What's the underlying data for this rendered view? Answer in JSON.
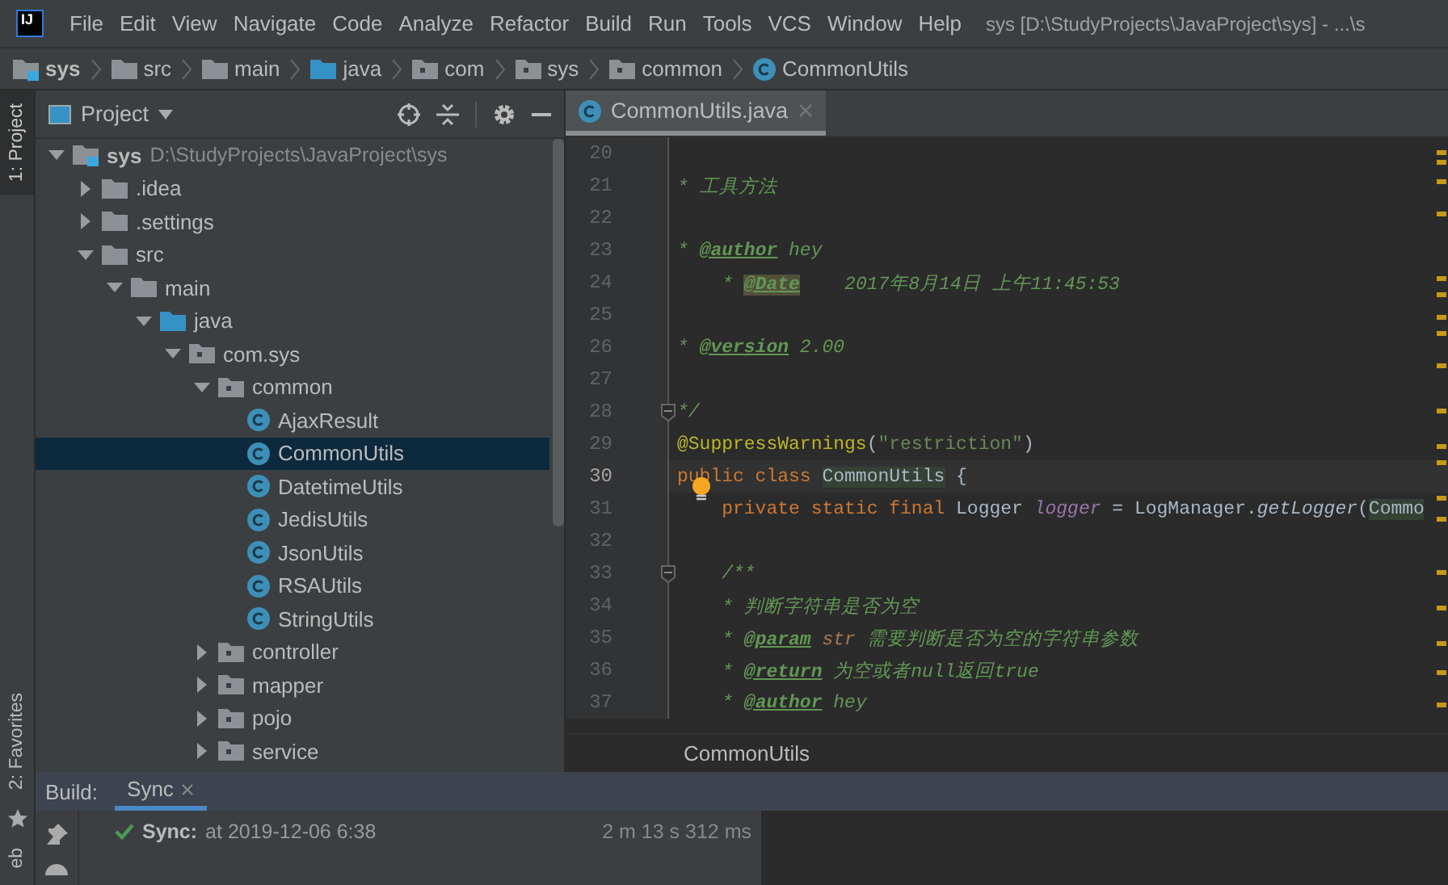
{
  "window": {
    "logo": "IJ",
    "title": "sys [D:\\StudyProjects\\JavaProject\\sys] - ...\\s"
  },
  "menu": [
    "File",
    "Edit",
    "View",
    "Navigate",
    "Code",
    "Analyze",
    "Refactor",
    "Build",
    "Run",
    "Tools",
    "VCS",
    "Window",
    "Help"
  ],
  "breadcrumb": [
    {
      "kind": "module",
      "label": "sys"
    },
    {
      "kind": "folder",
      "label": "src"
    },
    {
      "kind": "folder",
      "label": "main"
    },
    {
      "kind": "source-folder",
      "label": "java"
    },
    {
      "kind": "package",
      "label": "com"
    },
    {
      "kind": "package",
      "label": "sys"
    },
    {
      "kind": "package",
      "label": "common"
    },
    {
      "kind": "class",
      "label": "CommonUtils"
    }
  ],
  "side_strip": {
    "top_tab": {
      "label": "1: Project",
      "selected": true
    },
    "bottom_tabs": [
      {
        "label": "2: Favorites"
      },
      {
        "label": "eb"
      }
    ]
  },
  "project_panel": {
    "title": "Project",
    "items": [
      {
        "kind": "module",
        "label": "sys",
        "path": "D:\\StudyProjects\\JavaProject\\sys",
        "expanded": true,
        "selected": false,
        "children": [
          {
            "kind": "folder",
            "label": ".idea",
            "expanded": false,
            "selected": false
          },
          {
            "kind": "folder",
            "label": ".settings",
            "expanded": false,
            "selected": false
          },
          {
            "kind": "folder",
            "label": "src",
            "expanded": true,
            "selected": false,
            "children": [
              {
                "kind": "folder",
                "label": "main",
                "expanded": true,
                "selected": false,
                "children": [
                  {
                    "kind": "source-folder",
                    "label": "java",
                    "expanded": true,
                    "selected": false,
                    "children": [
                      {
                        "kind": "package",
                        "label": "com.sys",
                        "expanded": true,
                        "selected": false,
                        "children": [
                          {
                            "kind": "package",
                            "label": "common",
                            "expanded": true,
                            "selected": false,
                            "children": [
                              {
                                "kind": "class",
                                "label": "AjaxResult",
                                "selected": false
                              },
                              {
                                "kind": "class",
                                "label": "CommonUtils",
                                "selected": true
                              },
                              {
                                "kind": "class",
                                "label": "DatetimeUtils",
                                "selected": false
                              },
                              {
                                "kind": "class",
                                "label": "JedisUtils",
                                "selected": false
                              },
                              {
                                "kind": "class",
                                "label": "JsonUtils",
                                "selected": false
                              },
                              {
                                "kind": "class",
                                "label": "RSAUtils",
                                "selected": false
                              },
                              {
                                "kind": "class",
                                "label": "StringUtils",
                                "selected": false
                              }
                            ]
                          },
                          {
                            "kind": "package",
                            "label": "controller",
                            "expanded": false,
                            "selected": false
                          },
                          {
                            "kind": "package",
                            "label": "mapper",
                            "expanded": false,
                            "selected": false
                          },
                          {
                            "kind": "package",
                            "label": "pojo",
                            "expanded": false,
                            "selected": false
                          },
                          {
                            "kind": "package",
                            "label": "service",
                            "expanded": false,
                            "selected": false
                          }
                        ]
                      }
                    ]
                  }
                ]
              }
            ]
          }
        ]
      }
    ]
  },
  "editor": {
    "tabs": [
      {
        "label": "CommonUtils.java",
        "selected": true
      }
    ],
    "lines": [
      {
        "number": "20",
        "current": false,
        "fold": false
      },
      {
        "number": "21",
        "current": false,
        "fold": false,
        "tokens": [
          {
            "kind": "comment",
            "text": "* 工具方法"
          }
        ]
      },
      {
        "number": "22",
        "current": false,
        "fold": false
      },
      {
        "number": "23",
        "current": false,
        "fold": false,
        "tokens": [
          {
            "kind": "comment",
            "text": "* "
          },
          {
            "kind": "tag",
            "text": "@author"
          },
          {
            "kind": "comment",
            "text": " hey"
          }
        ]
      },
      {
        "number": "24",
        "current": false,
        "fold": false,
        "tokens": [
          {
            "kind": "comment",
            "text": "    * "
          },
          {
            "kind": "tag-highlight",
            "text": "@Date"
          },
          {
            "kind": "comment",
            "text": "    2017年8月14日 上午11:45:53"
          }
        ]
      },
      {
        "number": "25",
        "current": false,
        "fold": false
      },
      {
        "number": "26",
        "current": false,
        "fold": false,
        "tokens": [
          {
            "kind": "comment",
            "text": "* "
          },
          {
            "kind": "tag",
            "text": "@version"
          },
          {
            "kind": "comment",
            "text": " 2.00"
          }
        ]
      },
      {
        "number": "27",
        "current": false,
        "fold": false
      },
      {
        "number": "28",
        "current": false,
        "fold": true,
        "tokens": [
          {
            "kind": "comment",
            "text": "*/"
          }
        ]
      },
      {
        "number": "29",
        "current": false,
        "fold": false,
        "tokens": [
          {
            "kind": "annotation",
            "text": "@SuppressWarnings"
          },
          {
            "kind": "plain",
            "text": "("
          },
          {
            "kind": "string",
            "text": "\"restriction\""
          },
          {
            "kind": "plain",
            "text": ")"
          }
        ]
      },
      {
        "number": "30",
        "current": true,
        "fold": false,
        "tokens": [
          {
            "kind": "keyword",
            "text": "public class "
          },
          {
            "kind": "class-highlight",
            "text": "CommonUtils"
          },
          {
            "kind": "plain",
            "text": " {"
          }
        ]
      },
      {
        "number": "31",
        "current": false,
        "fold": false,
        "tokens": [
          {
            "kind": "keyword",
            "text": "    private static final "
          },
          {
            "kind": "plain",
            "text": "Logger "
          },
          {
            "kind": "field",
            "text": "logger"
          },
          {
            "kind": "plain",
            "text": " = LogManager."
          },
          {
            "kind": "static-call",
            "text": "getLogger"
          },
          {
            "kind": "plain",
            "text": "("
          },
          {
            "kind": "class-highlight",
            "text": "Commo"
          }
        ]
      },
      {
        "number": "32",
        "current": false,
        "fold": false
      },
      {
        "number": "33",
        "current": false,
        "fold": true,
        "tokens": [
          {
            "kind": "comment",
            "text": "    /**"
          }
        ]
      },
      {
        "number": "34",
        "current": false,
        "fold": false,
        "tokens": [
          {
            "kind": "comment",
            "text": "    * 判断字符串是否为空"
          }
        ]
      },
      {
        "number": "35",
        "current": false,
        "fold": false,
        "tokens": [
          {
            "kind": "comment",
            "text": "    * "
          },
          {
            "kind": "tag",
            "text": "@param"
          },
          {
            "kind": "param-ref",
            "text": " str"
          },
          {
            "kind": "comment",
            "text": " 需要判断是否为空的字符串参数"
          }
        ]
      },
      {
        "number": "36",
        "current": false,
        "fold": false,
        "tokens": [
          {
            "kind": "comment",
            "text": "    * "
          },
          {
            "kind": "tag",
            "text": "@return"
          },
          {
            "kind": "comment",
            "text": " 为空或者null返回true"
          }
        ]
      },
      {
        "number": "37",
        "current": false,
        "fold": false,
        "tokens": [
          {
            "kind": "comment",
            "text": "    * "
          },
          {
            "kind": "tag",
            "text": "@author"
          },
          {
            "kind": "comment",
            "text": " hey"
          }
        ]
      }
    ],
    "footer_breadcrumb": "CommonUtils"
  },
  "build_panel": {
    "label": "Build:",
    "tabs": [
      {
        "label": "Sync",
        "selected": true
      }
    ],
    "events": [
      {
        "title": "Sync:",
        "detail": "at 2019-12-06 6:38",
        "duration": "2 m 13 s 312 ms"
      }
    ]
  }
}
